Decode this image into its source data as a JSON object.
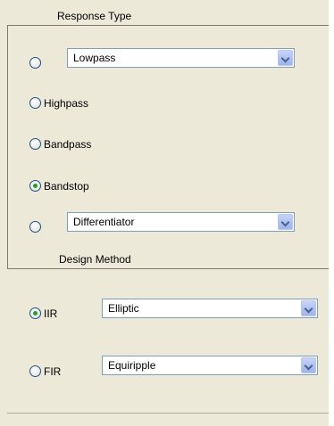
{
  "response_type": {
    "title": "Response Type",
    "lowpass_select": {
      "value": "Lowpass"
    },
    "options": {
      "highpass": "Highpass",
      "bandpass": "Bandpass",
      "bandstop": "Bandstop"
    },
    "selected": "Bandstop",
    "other_select": {
      "value": "Differentiator"
    }
  },
  "design_method": {
    "title": "Design Method",
    "iir_label": "IIR",
    "iir_select": {
      "value": "Elliptic"
    },
    "fir_label": "FIR",
    "fir_select": {
      "value": "Equiripple"
    },
    "selected": "IIR"
  },
  "colors": {
    "panel": "#ece9d8",
    "radio_checked": "#21a121",
    "dropdown_button": "#b1c4f4",
    "field_border": "#7f9db9"
  },
  "icons": {
    "dropdown": "chevron-down-icon"
  }
}
